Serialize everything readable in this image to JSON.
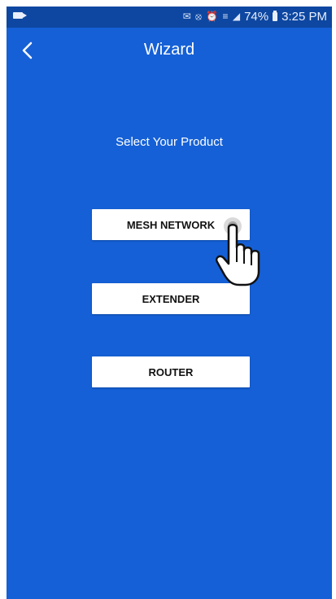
{
  "status_bar": {
    "icons": "✉ ⦻ ⏰ ≡ ◢",
    "battery": "74%",
    "time": "3:25 PM"
  },
  "app_bar": {
    "title": "Wizard"
  },
  "main": {
    "prompt": "Select Your Product",
    "products": [
      {
        "label": "MESH NETWORK"
      },
      {
        "label": "EXTENDER"
      },
      {
        "label": "ROUTER"
      }
    ]
  },
  "colors": {
    "background": "#1560d6",
    "status_bar": "#0d47a1",
    "button": "#ffffff",
    "button_text": "#111111"
  },
  "icons": {
    "back": "chevron-left-icon",
    "cursor": "hand-pointer-icon",
    "battery": "battery-icon",
    "video": "video-camera-icon"
  }
}
